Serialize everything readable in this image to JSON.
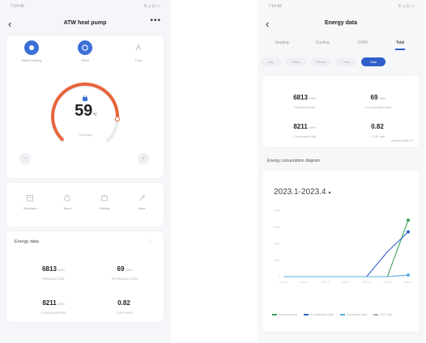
{
  "left": {
    "status": {
      "time": "7:14:49",
      "right": "8 ⊿ ⊡ ▭"
    },
    "title": "ATW heat pump",
    "modes": [
      {
        "label": "Water heating",
        "active": true
      },
      {
        "label": "Silent",
        "active": true
      },
      {
        "label": "Fast",
        "active": false
      }
    ],
    "temperature": {
      "value": "59",
      "unit": "℃",
      "label": "Currently",
      "level": 0.85
    },
    "minus": "−",
    "plus": "+",
    "functions": [
      {
        "label": "Schedule",
        "icon": "schedule-icon"
      },
      {
        "label": "Timer",
        "icon": "timer-icon"
      },
      {
        "label": "Holiday",
        "icon": "holiday-icon"
      },
      {
        "label": "More",
        "icon": "more-icon"
      }
    ],
    "energy": {
      "header": "Energy data",
      "items": [
        {
          "value": "6813",
          "unit": "kWh",
          "label": "PRODUCTION"
        },
        {
          "value": "69",
          "unit": "kWh",
          "label": "IN PRODUCTION"
        },
        {
          "value": "8211",
          "unit": "kWh",
          "label": "CONSUMPTION"
        },
        {
          "value": "0.82",
          "unit": "",
          "label": "COP RATE"
        }
      ]
    }
  },
  "right": {
    "status": {
      "time": "7:14:49",
      "right": "8 ⊿ ⊡ ▭"
    },
    "title": "Energy data",
    "tabs": [
      "Heating",
      "Cooling",
      "DHW",
      "Total"
    ],
    "active_tab": 3,
    "chips": [
      "Day",
      "Week",
      "Month",
      "Year",
      "Total"
    ],
    "active_chip": 4,
    "stats": [
      {
        "value": "6813",
        "unit": "kWh",
        "label": "Produced total"
      },
      {
        "value": "69",
        "unit": "kWh",
        "label": "In production total"
      },
      {
        "value": "8211",
        "unit": "kWh",
        "label": "Consumed total"
      },
      {
        "value": "0.82",
        "unit": "",
        "label": "COP rate"
      }
    ],
    "note": "Updated data 0:0",
    "diagram_title": "Energy consumption diagram",
    "range": "2023.1-2023.4",
    "legend": [
      {
        "name": "Produced total",
        "color": "#3aa05a"
      },
      {
        "name": "In production total",
        "color": "#2f5fc9"
      },
      {
        "name": "Consumed total",
        "color": "#5ab0e0"
      },
      {
        "name": "COP rate",
        "color": "#aaaaaa"
      }
    ]
  },
  "chart_data": {
    "type": "line",
    "x": [
      "2023.1",
      "2023.1",
      "2023.2",
      "2023.2",
      "2023.3",
      "2023.4",
      "2023.4"
    ],
    "series": [
      {
        "name": "Produced total",
        "color": "#3aa05a",
        "values": [
          0,
          0,
          0,
          0,
          0,
          0,
          6813
        ]
      },
      {
        "name": "In production total",
        "color": "#2f5fc9",
        "values": [
          0,
          0,
          0,
          0,
          0,
          3000,
          5400
        ]
      },
      {
        "name": "Consumed total",
        "color": "#5ab0e0",
        "values": [
          0,
          0,
          0,
          0,
          0,
          0,
          200
        ]
      }
    ],
    "ylim": [
      0,
      8000
    ],
    "grid": false,
    "legend_position": "bottom"
  }
}
